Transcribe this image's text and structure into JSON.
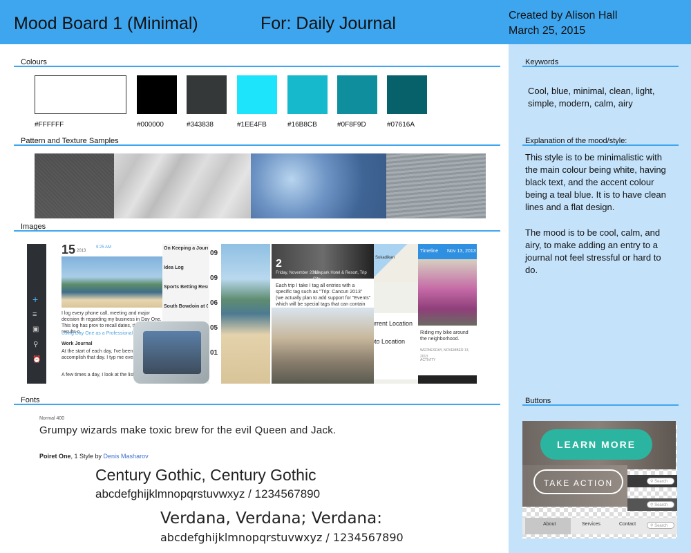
{
  "header": {
    "title": "Mood Board 1 (Minimal)",
    "for": "For: Daily Journal",
    "created_by": "Created by Alison Hall",
    "date": "March 25, 2015"
  },
  "sections": {
    "colours": "Colours",
    "patterns": "Pattern and Texture Samples",
    "images": "Images",
    "fonts": "Fonts",
    "keywords": "Keywords",
    "explanation": "Explanation of the mood/style:",
    "buttons": "Buttons"
  },
  "colours": [
    {
      "hex": "#FFFFFF",
      "label": "#FFFFFF"
    },
    {
      "hex": "#000000",
      "label": "#000000"
    },
    {
      "hex": "#343838",
      "label": "#343838"
    },
    {
      "hex": "#1EE4FB",
      "label": "#1EE4FB"
    },
    {
      "hex": "#16B8CB",
      "label": "#16B8CB"
    },
    {
      "hex": "#0F8F9D",
      "label": "#0F8F9D"
    },
    {
      "hex": "#07616A",
      "label": "#07616A"
    }
  ],
  "keywords_text": "Cool, blue, minimal, clean, light, simple, modern, calm, airy",
  "explanation": {
    "p1": "This style is to be minimalistic with the main colour being white, having black text, and the accent colour being a teal blue.  It is to have clean lines and a flat design.",
    "p2": "The mood is to be cool, calm, and airy, to make adding an entry to a journal not feel stressful or hard to do."
  },
  "fonts": {
    "poiret_weight": "Normal 400",
    "poiret_sample": "Grumpy wizards make toxic brew for the evil Queen and Jack.",
    "poiret_name": "Poiret One",
    "poiret_styles": ", 1 Style by ",
    "poiret_author": "Denis Masharov",
    "century_title": "Century Gothic, Century Gothic",
    "century_chars": "abcdefghijklmnopqrstuvwxyz / 1234567890",
    "verdana_title": "Verdana, Verdana; Verdana:",
    "verdana_chars": "abcdefghijklmnopqrstuvwxyz / 1234567890"
  },
  "images": {
    "journal_day": "15",
    "journal_year": "2013",
    "journal_time": "9:25 AM",
    "journal_text1": "I log every phone call, meeting and major decision th regarding my business in Day One. This log has prov to recall dates, times and the results o",
    "journal_link": "Using Day One as a Professional Journ",
    "journal_heading": "Work Journal",
    "journal_text2": "At the start of each day, I've been wit I want to accomplish that day. I typ me everywhere...",
    "journal_text3": "A few times a day, I look at the list and",
    "list_items": [
      "On Keeping a Journal",
      "Idea Log",
      "Sports Betting Results",
      "South Bowdoin at Coll..."
    ],
    "dates": [
      "09",
      "09",
      "06",
      "05",
      "01"
    ],
    "photo_date_day": "2",
    "photo_date_text": "Friday, November 2013",
    "photo_location": "Newpark Hotel & Resort, Trip City...",
    "photo_text": "Each trip I take I tag all entries with a specific tag such as \"Trip: Cancun 2013\" (we actually plan to add support for \"Events\" which will be special tags that can contain",
    "map_town": "Sukadikan",
    "current_location1": "urrent Location",
    "current_location2": "oto Location",
    "timeline_label": "Timeline",
    "timeline_date": "Nov 13, 2013",
    "caption": "Riding my bike around the neighborhood.",
    "weekday_line": "WEDNESDAY, NOVEMBER 13, 2013",
    "activity_line": "ACTIVITY"
  },
  "buttons": {
    "learn_more": "LEARN MORE",
    "take_action": "TAKE ACTION",
    "nav": [
      "About",
      "Services",
      "Contact"
    ],
    "search": "Search"
  }
}
